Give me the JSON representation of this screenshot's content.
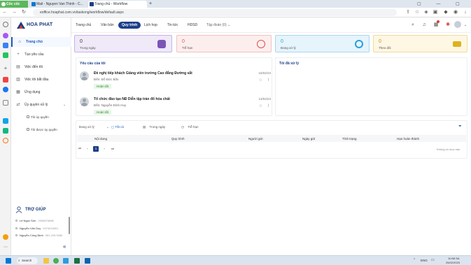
{
  "browser": {
    "tabs": [
      {
        "label": "Cốc cốc"
      },
      {
        "label": "Mail - Nguyen Van Thinh - C..."
      },
      {
        "label": "Trang chủ - Workflow"
      }
    ],
    "new_tab": "+",
    "url": "eoffice.hoaphat.com.vn/taskong/workflow/default.aspx"
  },
  "sidebar": {
    "logo": "HOA PHAT",
    "items": [
      {
        "label": "Trang chủ",
        "icon": "home-icon",
        "glyph": "⌂"
      },
      {
        "label": "Tạo yêu cầu",
        "icon": "plus-icon",
        "glyph": "+"
      },
      {
        "label": "Việc đến tôi",
        "icon": "inbox-icon",
        "glyph": "▤"
      },
      {
        "label": "Việc tôi bắt đầu",
        "icon": "outbox-icon",
        "glyph": "▥"
      },
      {
        "label": "Ứng dụng",
        "icon": "apps-icon",
        "glyph": "▦"
      },
      {
        "label": "Ủy quyền xử lý",
        "icon": "delegate-icon",
        "glyph": "⇄"
      }
    ],
    "sub_items": [
      {
        "label": "Tôi ủy quyền"
      },
      {
        "label": "Tôi được ủy quyền"
      }
    ],
    "support_title": "TRỢ GIÚP",
    "contacts": [
      {
        "name": "Lê Ngọc Sơn",
        "phone": "0936876686"
      },
      {
        "name": "Nguyễn Văn Duy",
        "phone": "0974016001"
      },
      {
        "name": "Nguyễn Công Định",
        "phone": "081.225.9080"
      }
    ],
    "collapse": "«"
  },
  "topnav": {
    "items": [
      {
        "label": "Trang chủ",
        "active": false
      },
      {
        "label": "Văn bản",
        "active": false
      },
      {
        "label": "Quy trình",
        "active": true
      },
      {
        "label": "Lịch họp",
        "active": false
      },
      {
        "label": "Tin tức",
        "active": false
      },
      {
        "label": "HDSD",
        "active": false
      },
      {
        "label": "Tập đoàn (0) ⌄",
        "active": false
      }
    ]
  },
  "stats": [
    {
      "value": "0",
      "label": "Trong ngày",
      "bg": "#efe9f8",
      "border": "#8e63c9",
      "icon_color": "#7b54b8"
    },
    {
      "value": "0",
      "label": "Trễ hạn",
      "bg": "#fdeeee",
      "border": "#e57373",
      "icon_color": "#d9534f"
    },
    {
      "value": "0",
      "label": "Đang xử lý",
      "bg": "#e6f4fb",
      "border": "#4aa8d8",
      "icon_color": "#2a9fd6"
    },
    {
      "value": "0",
      "label": "Theo dõi",
      "bg": "#fdf7e3",
      "border": "#e6c04a",
      "icon_color": "#e0b020"
    }
  ],
  "requests_panel": {
    "title": "Yêu cầu của tôi",
    "items": [
      {
        "title": "Đề nghị tiếp khách Giảng viên trường Cao đẳng Đường sắt",
        "from": "Đến: Đỗ Đức Bốn",
        "date": "16/02/23",
        "status": "Hoàn tất"
      },
      {
        "title": "Tổ chức đào tạo NĐ Diễn tập tràn đổ hóa chất",
        "from": "Đến: Nguyễn Đình Huy",
        "date": "13/02/23",
        "status": "Hoàn tất"
      }
    ]
  },
  "todo_panel": {
    "title": "Tôi đã xử lý"
  },
  "filters": {
    "status": "Đang xử lý",
    "all": "Tất cả",
    "today": "Trong ngày",
    "late": "Trễ hạn"
  },
  "table": {
    "headers": [
      "Nội dung",
      "Quy trình",
      "Người gửi",
      "Ngày gửi",
      "Tình trạng",
      "Hạn hoàn thành"
    ],
    "current_page": "1",
    "empty_text": "Không có mục nào"
  },
  "taskbar": {
    "search": "Search",
    "lang": "ENG",
    "time": "10:58 SA",
    "date": "25/02/2023"
  }
}
